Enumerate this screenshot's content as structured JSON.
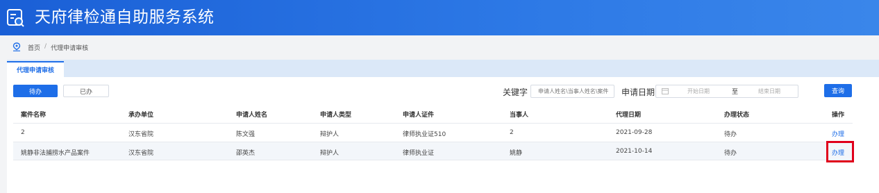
{
  "header": {
    "title": "天府律检通自助服务系统",
    "icon": "document-edit-icon"
  },
  "breadcrumb": {
    "items": [
      "首页",
      "代理申请审核"
    ],
    "separator": "/"
  },
  "tabs": [
    {
      "label": "代理申请审核",
      "active": true
    }
  ],
  "filters": {
    "status_buttons": [
      {
        "label": "待办",
        "active": true
      },
      {
        "label": "已办",
        "active": false
      }
    ],
    "keyword_label": "关键字",
    "keyword_placeholder": "申请人姓名\\当事人姓名\\案件",
    "date_label": "申请日期",
    "date_start_placeholder": "开始日期",
    "date_to": "至",
    "date_end_placeholder": "结束日期",
    "search_label": "查询"
  },
  "table": {
    "columns": [
      "案件名称",
      "承办单位",
      "申请人姓名",
      "申请人类型",
      "申请人证件",
      "当事人",
      "代理日期",
      "办理状态",
      "操作"
    ],
    "rows": [
      [
        "2",
        "汉东省院",
        "陈文强",
        "辩护人",
        "律师执业证510",
        "2",
        "2021-09-28",
        "待办",
        "办理"
      ],
      [
        "姚静非法捕捞水产品案件",
        "汉东省院",
        "邵英杰",
        "辩护人",
        "律师执业证",
        "姚静",
        "2021-10-14",
        "待办",
        "办理"
      ]
    ]
  },
  "colors": {
    "primary": "#1e6ee8",
    "header_gradient_start": "#1a5fd6",
    "highlight": "#e0001b"
  }
}
